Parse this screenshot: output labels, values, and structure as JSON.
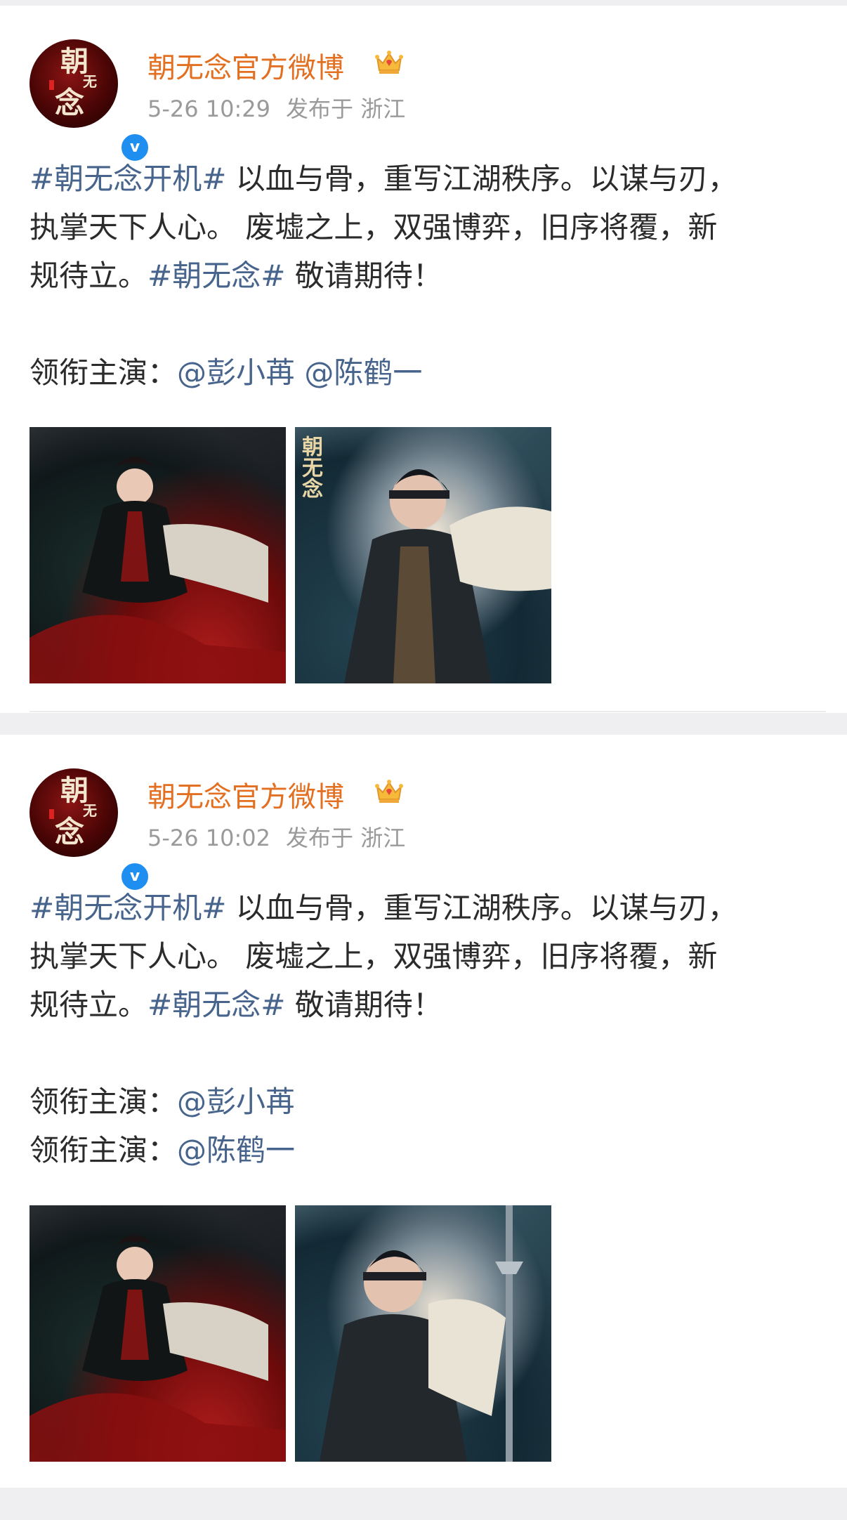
{
  "posts": [
    {
      "author": "朝无念官方微博",
      "time": "5-26 10:29",
      "location": "发布于 浙江",
      "avatar_text": [
        "朝",
        "无",
        "念"
      ],
      "verified_mark": "v",
      "content": {
        "line1": [
          {
            "text": "#朝无念开机#",
            "link": true
          },
          {
            "text": " 以血与骨，重写江湖秩序。以谋与刃，",
            "link": false
          }
        ],
        "line2": "执掌天下人心。 废墟之上，双强博弈，旧序将覆，新",
        "line3": [
          {
            "text": "规待立。",
            "link": false
          },
          {
            "text": "#朝无念#",
            "link": true
          },
          {
            "text": " 敬请期待！",
            "link": false
          }
        ],
        "cast_label": "领衔主演：",
        "cast_mentions": [
          "@彭小苒",
          "@陈鹤一"
        ]
      },
      "images": [
        "woman-in-black-and-red-poster",
        "swordsman-headband-poster"
      ]
    },
    {
      "author": "朝无念官方微博",
      "time": "5-26 10:02",
      "location": "发布于 浙江",
      "avatar_text": [
        "朝",
        "无",
        "念"
      ],
      "verified_mark": "v",
      "content": {
        "line1": [
          {
            "text": "#朝无念开机#",
            "link": true
          },
          {
            "text": " 以血与骨，重写江湖秩序。以谋与刃，",
            "link": false
          }
        ],
        "line2": "执掌天下人心。 废墟之上，双强博弈，旧序将覆，新",
        "line3": [
          {
            "text": "规待立。",
            "link": false
          },
          {
            "text": "#朝无念#",
            "link": true
          },
          {
            "text": " 敬请期待！",
            "link": false
          }
        ],
        "cast_label": "领衔主演：",
        "cast_mentions": [
          "@彭小苒",
          "@陈鹤一"
        ]
      },
      "images": [
        "woman-in-black-and-red-poster",
        "swordsman-with-sword-poster"
      ]
    }
  ],
  "poster_title_mark": "朝无念"
}
